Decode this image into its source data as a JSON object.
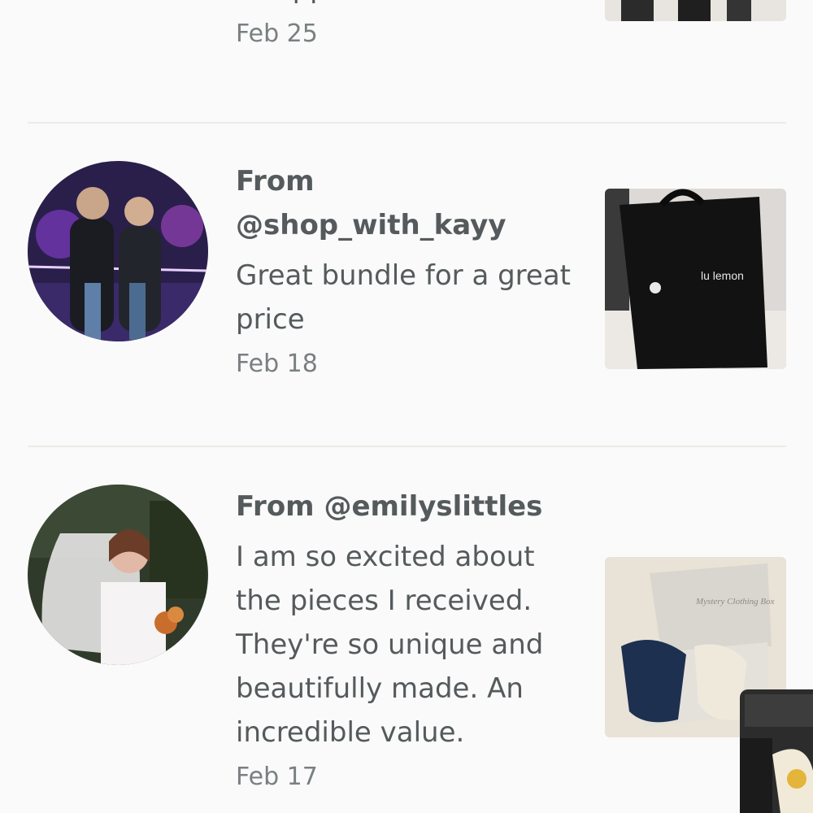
{
  "reviews": [
    {
      "from_label": "",
      "comment": "disappoint",
      "date": "Feb 25",
      "avatar_icon": "none",
      "thumbnail_icon": "product-photo-icon"
    },
    {
      "from_label": "From @shop_with_kayy",
      "comment": "Great bundle for a great price",
      "date": "Feb 18",
      "avatar_icon": "couple-photo-avatar",
      "thumbnail_icon": "lululemon-tote-bag-photo",
      "thumbnail_text": "lu lemon"
    },
    {
      "from_label": "From @emilyslittles",
      "comment": "I am so excited about the pieces I received. They're so unique and beautifully made. An incredible value.",
      "date": "Feb 17",
      "avatar_icon": "bride-photo-avatar",
      "thumbnail_icon": "mystery-box-photo",
      "thumbnail_text": "Mystery Clothing Box"
    }
  ],
  "colors": {
    "background": "#fafafa",
    "text_primary": "#555a5c",
    "text_secondary": "#7a7f82",
    "divider": "#ecebe6"
  }
}
